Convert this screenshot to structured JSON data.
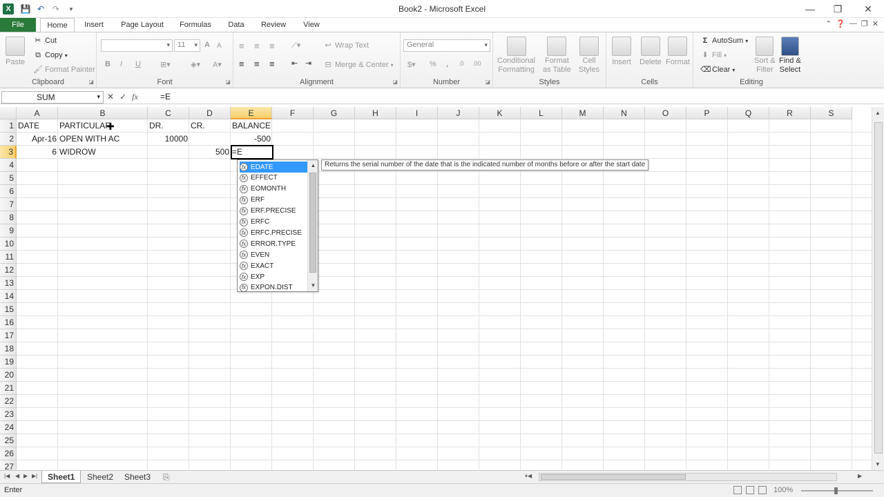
{
  "window": {
    "title": "Book2 - Microsoft Excel",
    "minimize": "—",
    "restore": "❐",
    "close": "✕"
  },
  "ribbon_tabs": {
    "file": "File",
    "items": [
      "Home",
      "Insert",
      "Page Layout",
      "Formulas",
      "Data",
      "Review",
      "View"
    ],
    "active": "Home"
  },
  "clipboard": {
    "paste": "Paste",
    "cut": "Cut",
    "copy": "Copy",
    "format_painter": "Format Painter",
    "label": "Clipboard"
  },
  "font": {
    "font_name": "",
    "font_size": "11",
    "bold": "B",
    "italic": "I",
    "underline": "U",
    "grow": "A",
    "shrink": "A",
    "label": "Font"
  },
  "alignment": {
    "wrap": "Wrap Text",
    "merge": "Merge & Center",
    "label": "Alignment"
  },
  "number": {
    "format": "General",
    "percent": "%",
    "comma": ",",
    "inc": ".0",
    "dec": ".00",
    "label": "Number"
  },
  "styles": {
    "conditional": "Conditional Formatting",
    "conditional_1": "Conditional",
    "conditional_2": "Formatting",
    "table_1": "Format",
    "table_2": "as Table",
    "cell_1": "Cell",
    "cell_2": "Styles",
    "label": "Styles"
  },
  "cells": {
    "insert": "Insert",
    "delete": "Delete",
    "format": "Format",
    "label": "Cells"
  },
  "editing": {
    "autosum": "AutoSum",
    "fill": "Fill",
    "clear": "Clear",
    "sort_1": "Sort &",
    "sort_2": "Filter",
    "find_1": "Find &",
    "find_2": "Select",
    "label": "Editing"
  },
  "formula_bar": {
    "name_box": "SUM",
    "fx": "fx",
    "cancel": "✕",
    "enter": "✓",
    "content": "=E"
  },
  "columns": [
    "A",
    "B",
    "C",
    "D",
    "E",
    "F",
    "G",
    "H",
    "I",
    "J",
    "K",
    "L",
    "M",
    "N",
    "O",
    "P",
    "Q",
    "R",
    "S"
  ],
  "rows": [
    "1",
    "2",
    "3",
    "4",
    "5",
    "6",
    "7",
    "8",
    "9",
    "10",
    "11",
    "12",
    "13",
    "14",
    "15",
    "16",
    "17",
    "18",
    "19",
    "20",
    "21",
    "22",
    "23",
    "24",
    "25",
    "26",
    "27"
  ],
  "cells_data": {
    "A1": "DATE",
    "B1": "PARTICULAR",
    "C1": "DR.",
    "D1": "CR.",
    "E1": "BALANCE",
    "A2": "Apr-16",
    "B2": "OPEN WITH AC",
    "C2": "10000",
    "E2": "-500",
    "A3": "6",
    "B3": "WIDROW",
    "D3": "500",
    "E3": "=E"
  },
  "autocomplete": {
    "items": [
      "EDATE",
      "EFFECT",
      "EOMONTH",
      "ERF",
      "ERF.PRECISE",
      "ERFC",
      "ERFC.PRECISE",
      "ERROR.TYPE",
      "EVEN",
      "EXACT",
      "EXP",
      "EXPON.DIST"
    ],
    "selected": "EDATE",
    "tooltip": "Returns the serial number of the date that is the indicated number of months before or after the start date"
  },
  "sheets": {
    "tabs": [
      "Sheet1",
      "Sheet2",
      "Sheet3"
    ],
    "active": "Sheet1"
  },
  "status": {
    "mode": "Enter",
    "zoom": "100%"
  }
}
